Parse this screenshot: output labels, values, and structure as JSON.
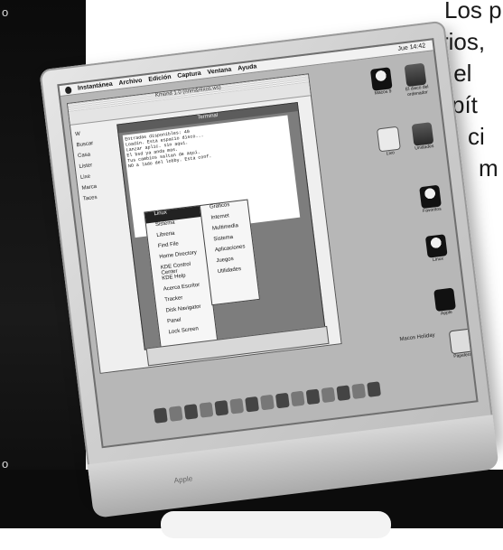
{
  "page": {
    "edge_left_top": "o",
    "edge_left_bottom": "o"
  },
  "article": {
    "lines": [
      "Los  p",
      "rios,",
      "y el",
      "pít",
      "ci",
      "m"
    ]
  },
  "screen": {
    "menubar": {
      "items": [
        "Instantánea",
        "Archivo",
        "Edición",
        "Captura",
        "Ventana",
        "Ayuda"
      ],
      "clock": "Jue 14:42"
    },
    "browser": {
      "title": "Kmond 1.0 (nnm&nixos.ws)",
      "sidebar_items": [
        "W",
        "Buscar",
        "Casa",
        "Lister",
        "Lixe",
        "Marca",
        "Taces"
      ]
    },
    "terminal": {
      "title": "Terminal",
      "lines": [
        "Entradas disponibles: 40",
        "Loadin. Esta espacio disco...",
        "Lanzar aplic. sin aqui.",
        "El bsd ya anda mas.",
        "Tus cambios saltan de aqui.",
        "NO a lado del lobby. Esta conf."
      ]
    },
    "menu_primary": [
      "Linux",
      "Sistema",
      "Libreria",
      "Find File",
      "Home Directory",
      "KDE Control Center",
      "KDE Help",
      "Acerca Escritor",
      "Tracker",
      "Disk Navigator",
      "Panel",
      "Lock Screen",
      "Logout"
    ],
    "menu_secondary": [
      "Gráficos",
      "Internet",
      "Multimedia",
      "Sistema",
      "Aplicaciones",
      "Juegos",
      "Utilidades"
    ],
    "desktop_icons": [
      {
        "label": "Macos 9",
        "kind": "penguin-icon"
      },
      {
        "label": "El disco del ordenador",
        "kind": "drive-icon"
      },
      {
        "label": "Lixo",
        "kind": "folder-icon"
      },
      {
        "label": "Unidades",
        "kind": "drive-icon"
      },
      {
        "label": "Favoritos",
        "kind": "penguin-icon"
      },
      {
        "label": "Linux",
        "kind": "penguin-icon"
      },
      {
        "label": "Apple",
        "kind": "apple-icon"
      },
      {
        "label": "Papelera",
        "kind": "trash-icon"
      }
    ],
    "desktop_footer_label": "Macos Holiday",
    "brand_text": "Apple"
  }
}
